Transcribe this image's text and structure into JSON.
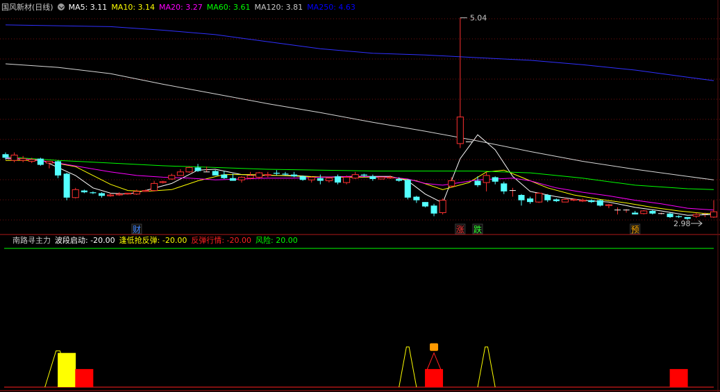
{
  "main_panel": {
    "title": "国风新材(日线)",
    "ma": [
      {
        "label": "MA5",
        "value": "3.11",
        "color": "#ffffff"
      },
      {
        "label": "MA10",
        "value": "3.14",
        "color": "#ffff00"
      },
      {
        "label": "MA20",
        "value": "3.27",
        "color": "#ff00ff"
      },
      {
        "label": "MA60",
        "value": "3.61",
        "color": "#00ff00"
      },
      {
        "label": "MA120",
        "value": "3.81",
        "color": "#c8c8c8"
      },
      {
        "label": "MA250",
        "value": "4.63",
        "color": "#0000ff"
      }
    ],
    "high_label": "5.04",
    "low_label": "2.98",
    "event_markers": [
      {
        "text": "财",
        "color": "#4488ff",
        "bar_index": 15
      },
      {
        "text": "涨",
        "color": "#ff3333",
        "bar_index": 52
      },
      {
        "text": "跌",
        "color": "#33ff33",
        "bar_index": 54
      },
      {
        "text": "预",
        "color": "#ffaa00",
        "bar_index": 72
      }
    ]
  },
  "indicator_panel": {
    "name": "南路寻主力",
    "items": [
      {
        "label": "波段启动",
        "value": "-20.00",
        "color": "#ffffff"
      },
      {
        "label": "逢低抢反弹",
        "value": "-20.00",
        "color": "#ffff00"
      },
      {
        "label": "反弹行情",
        "value": "-20.00",
        "color": "#ff2020"
      },
      {
        "label": "风险",
        "value": "20.00",
        "color": "#00ff00"
      }
    ]
  },
  "chart_data": {
    "type": "candlestick",
    "price_range": [
      2.98,
      5.04
    ],
    "candles": [
      [
        3.5,
        3.46,
        3.52,
        3.44
      ],
      [
        3.43,
        3.49,
        3.52,
        3.41
      ],
      [
        3.43,
        3.45,
        3.48,
        3.41
      ],
      [
        3.42,
        3.44,
        3.46,
        3.4
      ],
      [
        3.45,
        3.38,
        3.46,
        3.37
      ],
      [
        3.4,
        3.42,
        3.42,
        3.34
      ],
      [
        3.42,
        3.26,
        3.43,
        3.23
      ],
      [
        3.28,
        3.01,
        3.29,
        2.98
      ],
      [
        3.01,
        3.1,
        3.12,
        3.0
      ],
      [
        3.09,
        3.07,
        3.1,
        3.06
      ],
      [
        3.07,
        3.06,
        3.08,
        3.05
      ],
      [
        3.06,
        3.03,
        3.07,
        3.01
      ],
      [
        3.03,
        3.04,
        3.06,
        3.02
      ],
      [
        3.04,
        3.05,
        3.07,
        3.03
      ],
      [
        3.05,
        3.06,
        3.06,
        3.05
      ],
      [
        3.05,
        3.08,
        3.1,
        3.04
      ],
      [
        3.08,
        3.09,
        3.1,
        3.08
      ],
      [
        3.09,
        3.17,
        3.2,
        3.08
      ],
      [
        3.18,
        3.19,
        3.2,
        3.17
      ],
      [
        3.22,
        3.26,
        3.28,
        3.21
      ],
      [
        3.26,
        3.3,
        3.33,
        3.26
      ],
      [
        3.3,
        3.35,
        3.36,
        3.29
      ],
      [
        3.35,
        3.31,
        3.39,
        3.3
      ],
      [
        3.3,
        3.3,
        3.36,
        3.3
      ],
      [
        3.31,
        3.26,
        3.32,
        3.26
      ],
      [
        3.27,
        3.23,
        3.31,
        3.22
      ],
      [
        3.23,
        3.2,
        3.28,
        3.2
      ],
      [
        3.21,
        3.24,
        3.25,
        3.18
      ],
      [
        3.23,
        3.26,
        3.3,
        3.22
      ],
      [
        3.24,
        3.29,
        3.3,
        3.22
      ],
      [
        3.26,
        3.27,
        3.3,
        3.24
      ],
      [
        3.29,
        3.28,
        3.32,
        3.26
      ],
      [
        3.28,
        3.27,
        3.3,
        3.26
      ],
      [
        3.27,
        3.25,
        3.3,
        3.24
      ],
      [
        3.25,
        3.21,
        3.26,
        3.2
      ],
      [
        3.21,
        3.24,
        3.25,
        3.18
      ],
      [
        3.23,
        3.2,
        3.27,
        3.16
      ],
      [
        3.2,
        3.23,
        3.24,
        3.18
      ],
      [
        3.25,
        3.18,
        3.27,
        3.16
      ],
      [
        3.18,
        3.24,
        3.26,
        3.16
      ],
      [
        3.23,
        3.27,
        3.3,
        3.22
      ],
      [
        3.27,
        3.26,
        3.28,
        3.24
      ],
      [
        3.25,
        3.22,
        3.27,
        3.2
      ],
      [
        3.22,
        3.24,
        3.24,
        3.22
      ],
      [
        3.23,
        3.24,
        3.26,
        3.22
      ],
      [
        3.22,
        3.2,
        3.24,
        3.19
      ],
      [
        3.21,
        3.01,
        3.22,
        2.99
      ],
      [
        3.02,
        2.98,
        3.03,
        2.95
      ],
      [
        2.96,
        2.91,
        2.96,
        2.9
      ],
      [
        2.92,
        2.83,
        2.94,
        2.8
      ],
      [
        2.84,
        2.98,
        3.0,
        2.82
      ],
      [
        3.14,
        3.2,
        3.24,
        3.12
      ],
      [
        3.62,
        3.92,
        5.04,
        3.57
      ],
      [
        3.64,
        3.64,
        3.64,
        3.64
      ],
      [
        3.2,
        3.15,
        3.25,
        3.13
      ],
      [
        3.18,
        3.26,
        3.3,
        3.08
      ],
      [
        3.24,
        3.19,
        3.25,
        3.16
      ],
      [
        3.17,
        3.08,
        3.19,
        3.05
      ],
      [
        3.09,
        3.09,
        3.12,
        3.02
      ],
      [
        3.04,
        2.98,
        3.05,
        2.92
      ],
      [
        3.0,
        2.96,
        3.02,
        2.94
      ],
      [
        2.96,
        3.06,
        3.07,
        2.95
      ],
      [
        3.04,
        2.98,
        3.05,
        2.96
      ],
      [
        2.99,
        2.97,
        3.0,
        2.96
      ],
      [
        2.96,
        2.99,
        3.01,
        2.96
      ],
      [
        2.98,
        2.99,
        3.0,
        2.97
      ],
      [
        2.97,
        2.98,
        3.0,
        2.96
      ],
      [
        2.98,
        2.96,
        2.99,
        2.95
      ],
      [
        2.98,
        2.92,
        2.99,
        2.91
      ],
      [
        2.92,
        2.93,
        2.94,
        2.89
      ],
      [
        2.87,
        2.87,
        2.9,
        2.82
      ],
      [
        2.87,
        2.87,
        2.88,
        2.84
      ],
      [
        2.84,
        2.82,
        2.86,
        2.82
      ],
      [
        2.83,
        2.86,
        2.87,
        2.82
      ],
      [
        2.86,
        2.83,
        2.87,
        2.82
      ],
      [
        2.83,
        2.83,
        2.84,
        2.82
      ],
      [
        2.83,
        2.79,
        2.84,
        2.78
      ],
      [
        2.8,
        2.79,
        2.81,
        2.78
      ],
      [
        2.79,
        2.77,
        2.79,
        2.76
      ],
      [
        2.8,
        2.82,
        2.84,
        2.78
      ],
      [
        2.82,
        2.82,
        2.84,
        2.79
      ],
      [
        2.79,
        2.85,
        2.98,
        2.78
      ]
    ],
    "ma_series": [
      {
        "name": "MA5",
        "color": "#ffffff",
        "values": [
          [
            0,
            3.45
          ],
          [
            4,
            3.44
          ],
          [
            8,
            3.26
          ],
          [
            10,
            3.12
          ],
          [
            12,
            3.06
          ],
          [
            14,
            3.05
          ],
          [
            16,
            3.09
          ],
          [
            19,
            3.17
          ],
          [
            22,
            3.32
          ],
          [
            24,
            3.33
          ],
          [
            27,
            3.27
          ],
          [
            30,
            3.26
          ],
          [
            33,
            3.26
          ],
          [
            36,
            3.24
          ],
          [
            40,
            3.25
          ],
          [
            44,
            3.25
          ],
          [
            46,
            3.2
          ],
          [
            48,
            3.05
          ],
          [
            50,
            2.95
          ],
          [
            52,
            3.45
          ],
          [
            54,
            3.72
          ],
          [
            56,
            3.55
          ],
          [
            58,
            3.25
          ],
          [
            60,
            3.08
          ],
          [
            63,
            3.02
          ],
          [
            66,
            2.98
          ],
          [
            69,
            2.96
          ],
          [
            72,
            2.9
          ],
          [
            75,
            2.86
          ],
          [
            78,
            2.81
          ],
          [
            81,
            2.82
          ]
        ]
      },
      {
        "name": "MA10",
        "color": "#ffff00",
        "values": [
          [
            0,
            3.43
          ],
          [
            4,
            3.43
          ],
          [
            8,
            3.36
          ],
          [
            10,
            3.26
          ],
          [
            12,
            3.16
          ],
          [
            14,
            3.09
          ],
          [
            16,
            3.08
          ],
          [
            19,
            3.1
          ],
          [
            22,
            3.2
          ],
          [
            25,
            3.27
          ],
          [
            28,
            3.27
          ],
          [
            31,
            3.26
          ],
          [
            34,
            3.25
          ],
          [
            37,
            3.24
          ],
          [
            40,
            3.24
          ],
          [
            44,
            3.24
          ],
          [
            47,
            3.2
          ],
          [
            50,
            3.1
          ],
          [
            53,
            3.18
          ],
          [
            55,
            3.3
          ],
          [
            57,
            3.32
          ],
          [
            59,
            3.24
          ],
          [
            62,
            3.12
          ],
          [
            65,
            3.04
          ],
          [
            68,
            2.99
          ],
          [
            71,
            2.95
          ],
          [
            74,
            2.9
          ],
          [
            77,
            2.86
          ],
          [
            80,
            2.83
          ],
          [
            81,
            2.83
          ]
        ]
      },
      {
        "name": "MA20",
        "color": "#ff00ff",
        "values": [
          [
            0,
            3.46
          ],
          [
            3,
            3.44
          ],
          [
            6,
            3.4
          ],
          [
            9,
            3.35
          ],
          [
            12,
            3.3
          ],
          [
            15,
            3.26
          ],
          [
            18,
            3.24
          ],
          [
            21,
            3.23
          ],
          [
            24,
            3.21
          ],
          [
            27,
            3.22
          ],
          [
            30,
            3.23
          ],
          [
            33,
            3.23
          ],
          [
            36,
            3.24
          ],
          [
            40,
            3.25
          ],
          [
            44,
            3.24
          ],
          [
            46,
            3.22
          ],
          [
            48,
            3.17
          ],
          [
            50,
            3.15
          ],
          [
            52,
            3.18
          ],
          [
            54,
            3.21
          ],
          [
            56,
            3.22
          ],
          [
            58,
            3.23
          ],
          [
            60,
            3.2
          ],
          [
            63,
            3.12
          ],
          [
            66,
            3.07
          ],
          [
            69,
            3.03
          ],
          [
            72,
            2.98
          ],
          [
            75,
            2.94
          ],
          [
            78,
            2.89
          ],
          [
            81,
            2.87
          ]
        ]
      },
      {
        "name": "MA60",
        "color": "#00ff00",
        "values": [
          [
            0,
            3.47
          ],
          [
            6,
            3.43
          ],
          [
            12,
            3.4
          ],
          [
            18,
            3.37
          ],
          [
            24,
            3.35
          ],
          [
            30,
            3.33
          ],
          [
            36,
            3.32
          ],
          [
            42,
            3.31
          ],
          [
            48,
            3.31
          ],
          [
            54,
            3.31
          ],
          [
            60,
            3.29
          ],
          [
            66,
            3.23
          ],
          [
            72,
            3.15
          ],
          [
            78,
            3.11
          ],
          [
            81,
            3.1
          ]
        ]
      },
      {
        "name": "MA120",
        "color": "#d8d8d8",
        "values": [
          [
            0,
            4.52
          ],
          [
            6,
            4.48
          ],
          [
            12,
            4.41
          ],
          [
            18,
            4.29
          ],
          [
            24,
            4.18
          ],
          [
            30,
            4.07
          ],
          [
            36,
            3.97
          ],
          [
            42,
            3.86
          ],
          [
            48,
            3.76
          ],
          [
            54,
            3.65
          ],
          [
            60,
            3.53
          ],
          [
            66,
            3.42
          ],
          [
            72,
            3.33
          ],
          [
            78,
            3.25
          ],
          [
            81,
            3.21
          ]
        ]
      },
      {
        "name": "MA250",
        "color": "#3030ff",
        "values": [
          [
            0,
            4.96
          ],
          [
            6,
            4.95
          ],
          [
            12,
            4.94
          ],
          [
            18,
            4.9
          ],
          [
            24,
            4.85
          ],
          [
            30,
            4.77
          ],
          [
            36,
            4.69
          ],
          [
            42,
            4.64
          ],
          [
            48,
            4.62
          ],
          [
            54,
            4.59
          ],
          [
            60,
            4.56
          ],
          [
            66,
            4.51
          ],
          [
            72,
            4.45
          ],
          [
            78,
            4.37
          ],
          [
            81,
            4.33
          ]
        ]
      }
    ],
    "indicator_signals": [
      {
        "type": "yellow-line",
        "bar_index": 6,
        "width": 3,
        "level": 0.9
      },
      {
        "type": "yellow-bar",
        "bar_index": 7,
        "level": 0.85
      },
      {
        "type": "red-bar",
        "bar_index": 9,
        "level": 0.45
      },
      {
        "type": "yellow-line",
        "bar_index": 46,
        "width": 2,
        "level": 1.0
      },
      {
        "type": "red-bar",
        "bar_index": 49,
        "level": 0.45
      },
      {
        "type": "red-line",
        "bar_index": 49,
        "width": 1,
        "level": 0.85
      },
      {
        "type": "yellow-line",
        "bar_index": 55,
        "width": 2,
        "level": 1.0
      },
      {
        "type": "red-bar",
        "bar_index": 77,
        "level": 0.45
      }
    ]
  }
}
